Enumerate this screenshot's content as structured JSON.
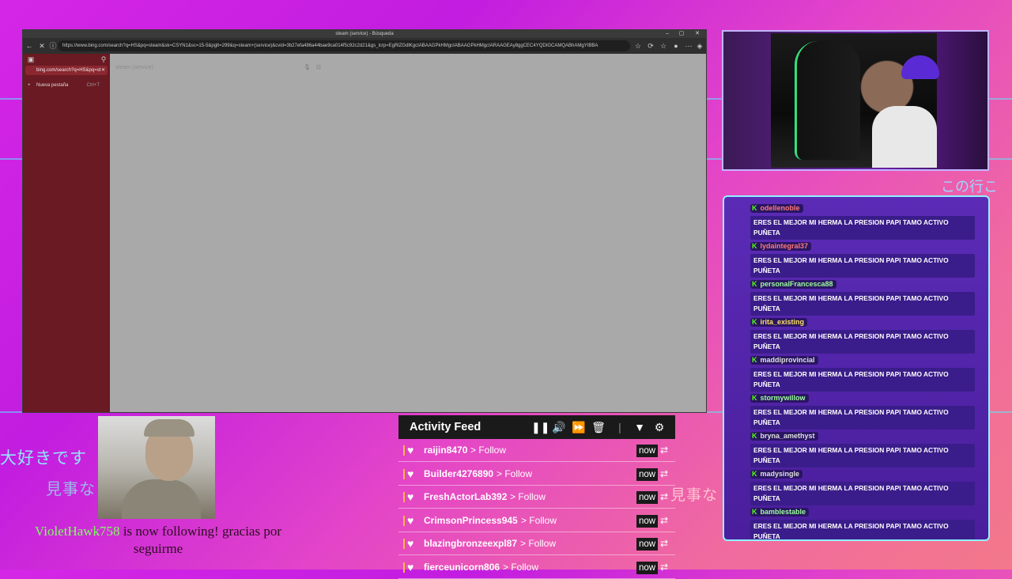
{
  "browser": {
    "window_title": "steam (service) - Búsqueda",
    "url": "https://www.bing.com/search?q=HS&pq=steam&sk=CSYN1&sc=15-5&pglt=299&q=steam+(service)&cvid=3b27efa486a44bae9ca014f5c92c2d21&gs_lcrp=EgRlZGdlKgcIABAAGPkHMgcIABAAGPkHMgcIARAAGEAy8ggCEC4YQDIGCAMQABhAMgYIBBA",
    "search_value": "steam (service)",
    "sidebar": {
      "active_tab": "bing.com/search?q=HS&pq=st",
      "new_tab": "Nueva pestaña",
      "new_tab_shortcut": "Ctrl+T"
    }
  },
  "overlay": {
    "jp_left_1": "大好きです",
    "jp_left_2": "見事な",
    "jp_mid": "見事な",
    "jp_right": "この行こ",
    "follow_alert": {
      "name": "VioletHawk758",
      "message": "is now following! gracias por seguirme"
    }
  },
  "chat": {
    "messages": [
      {
        "user": "odellenoble",
        "color": "#ff7a7a",
        "text": "ERES EL MEJOR MI HERMA LA PRESION PAPI TAMO ACTIVO PUÑETA"
      },
      {
        "user": "lydaintegral37",
        "color": "#ff7a7a",
        "text": "ERES EL MEJOR MI HERMA LA PRESION PAPI TAMO ACTIVO PUÑETA"
      },
      {
        "user": "personalFrancesca88",
        "color": "#9cff9c",
        "text": "ERES EL MEJOR MI HERMA LA PRESION PAPI TAMO ACTIVO PUÑETA"
      },
      {
        "user": "irita_existing",
        "color": "#ffe066",
        "text": "ERES EL MEJOR MI HERMA LA PRESION PAPI TAMO ACTIVO PUÑETA"
      },
      {
        "user": "maddiprovincial",
        "color": "#e0e0e0",
        "text": "ERES EL MEJOR MI HERMA LA PRESION PAPI TAMO ACTIVO PUÑETA"
      },
      {
        "user": "stormywillow",
        "color": "#9cff9c",
        "text": "ERES EL MEJOR MI HERMA LA PRESION PAPI TAMO ACTIVO PUÑETA"
      },
      {
        "user": "bryna_amethyst",
        "color": "#e0e0e0",
        "text": "ERES EL MEJOR MI HERMA LA PRESION PAPI TAMO ACTIVO PUÑETA"
      },
      {
        "user": "madysingle",
        "color": "#e0e0e0",
        "text": "ERES EL MEJOR MI HERMA LA PRESION PAPI TAMO ACTIVO PUÑETA"
      },
      {
        "user": "bamblestable",
        "color": "#9cff9c",
        "text": "ERES EL MEJOR MI HERMA LA PRESION PAPI TAMO ACTIVO PUÑETA"
      }
    ]
  },
  "feed": {
    "title": "Activity Feed",
    "controls": [
      "pause-icon",
      "volume-icon",
      "skip-icon",
      "trash-icon",
      "filter-icon",
      "gear-icon"
    ],
    "rows": [
      {
        "user": "raijin8470",
        "action": "> Follow",
        "time": "now"
      },
      {
        "user": "Builder4276890",
        "action": "> Follow",
        "time": "now"
      },
      {
        "user": "FreshActorLab392",
        "action": "> Follow",
        "time": "now"
      },
      {
        "user": "CrimsonPrincess945",
        "action": "> Follow",
        "time": "now"
      },
      {
        "user": "blazingbronzeexpl87",
        "action": "> Follow",
        "time": "now"
      },
      {
        "user": "fierceunicorn806",
        "action": "> Follow",
        "time": "now"
      }
    ]
  }
}
